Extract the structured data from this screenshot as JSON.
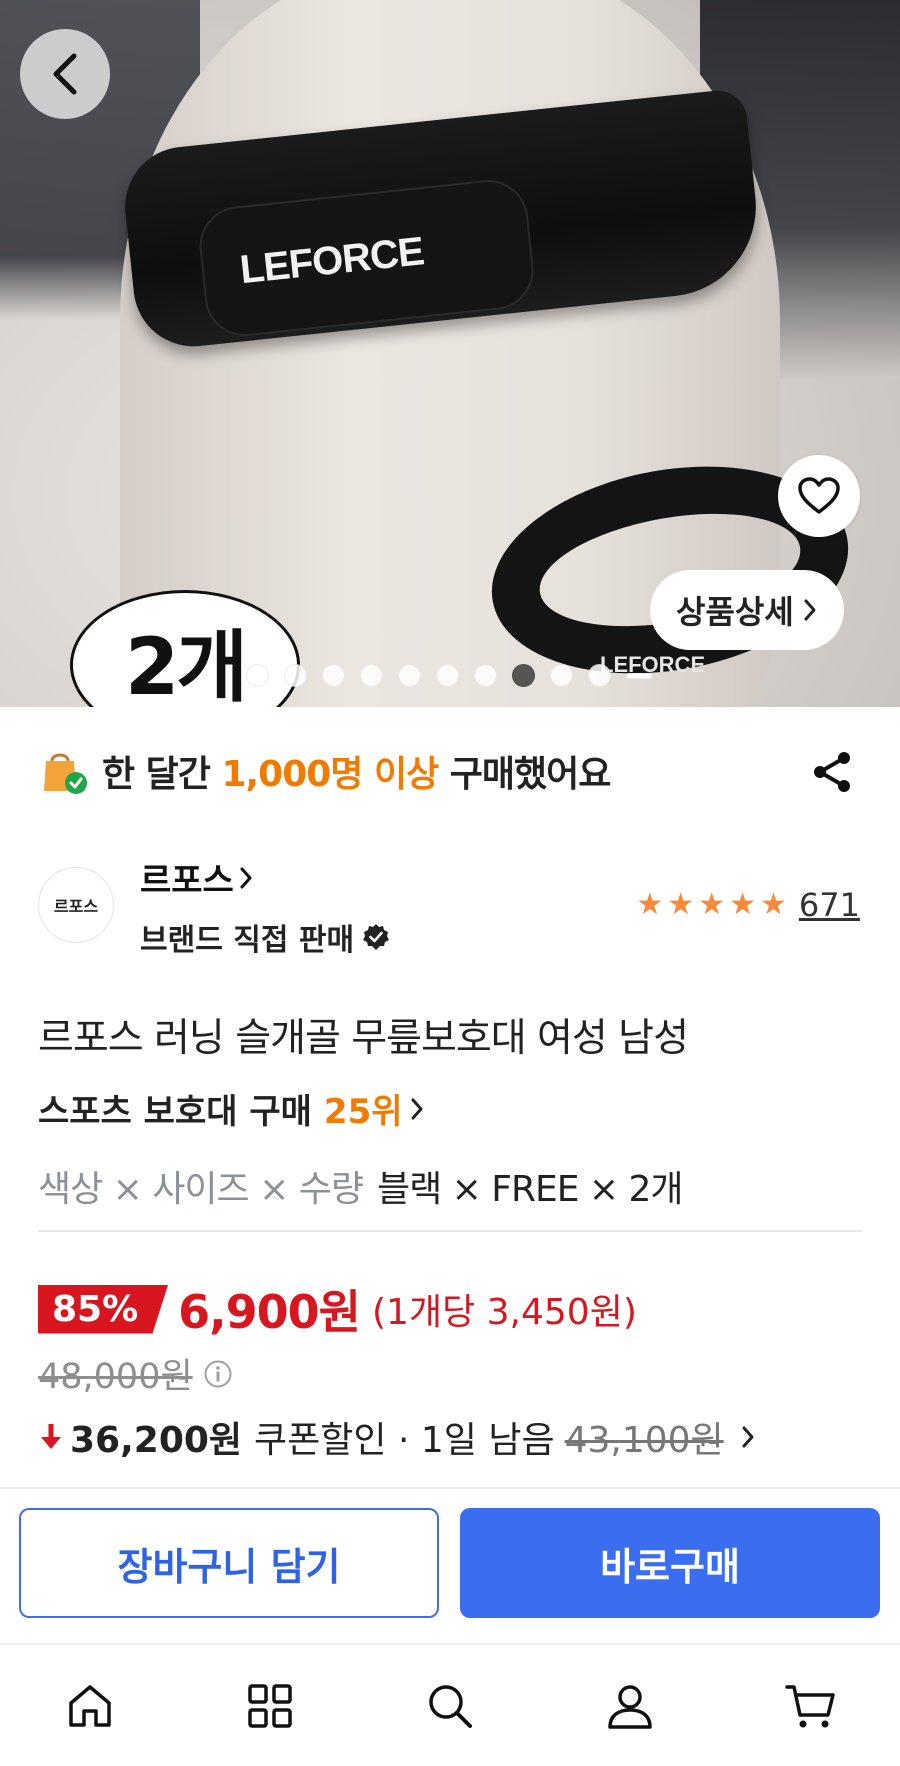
{
  "hero": {
    "strap_logo": "LEFORCE",
    "strap2_logo": "LEFORCE",
    "quantity_badge": "2개",
    "detail_button": "상품상세",
    "slide_count": 10,
    "active_slide": 7
  },
  "banner": {
    "prefix": "한 달간 ",
    "highlight": "1,000명 이상",
    "suffix": " 구매했어요"
  },
  "seller": {
    "logo_text": "르포스",
    "name": "르포스",
    "subtitle": "브랜드 직접 판매",
    "rating_stars": 5,
    "review_count": "671"
  },
  "product": {
    "title": "르포스 러닝 슬개골 무릎보호대 여성 남성",
    "rank_category": "스포츠 보호대 구매",
    "rank": "25위",
    "option_label": "색상 × 사이즈 × 수량",
    "option_value": "블랙 × FREE × 2개"
  },
  "price": {
    "discount": "85%",
    "sale_price": "6,900원",
    "unit_price": "(1개당 3,450원)",
    "original_price": "48,000원",
    "coupon_price": "36,200원",
    "coupon_text": "쿠폰할인 · 1일 남음",
    "coupon_original": "43,100원"
  },
  "actions": {
    "cart": "장바구니 담기",
    "buy": "바로구매"
  },
  "colors": {
    "accent_blue": "#3a6df0",
    "sale_red": "#d7161f",
    "highlight_orange": "#f07b00",
    "star": "#f7893a"
  },
  "nav": [
    "home-icon",
    "category-icon",
    "search-icon",
    "my-page-icon",
    "cart-icon"
  ]
}
